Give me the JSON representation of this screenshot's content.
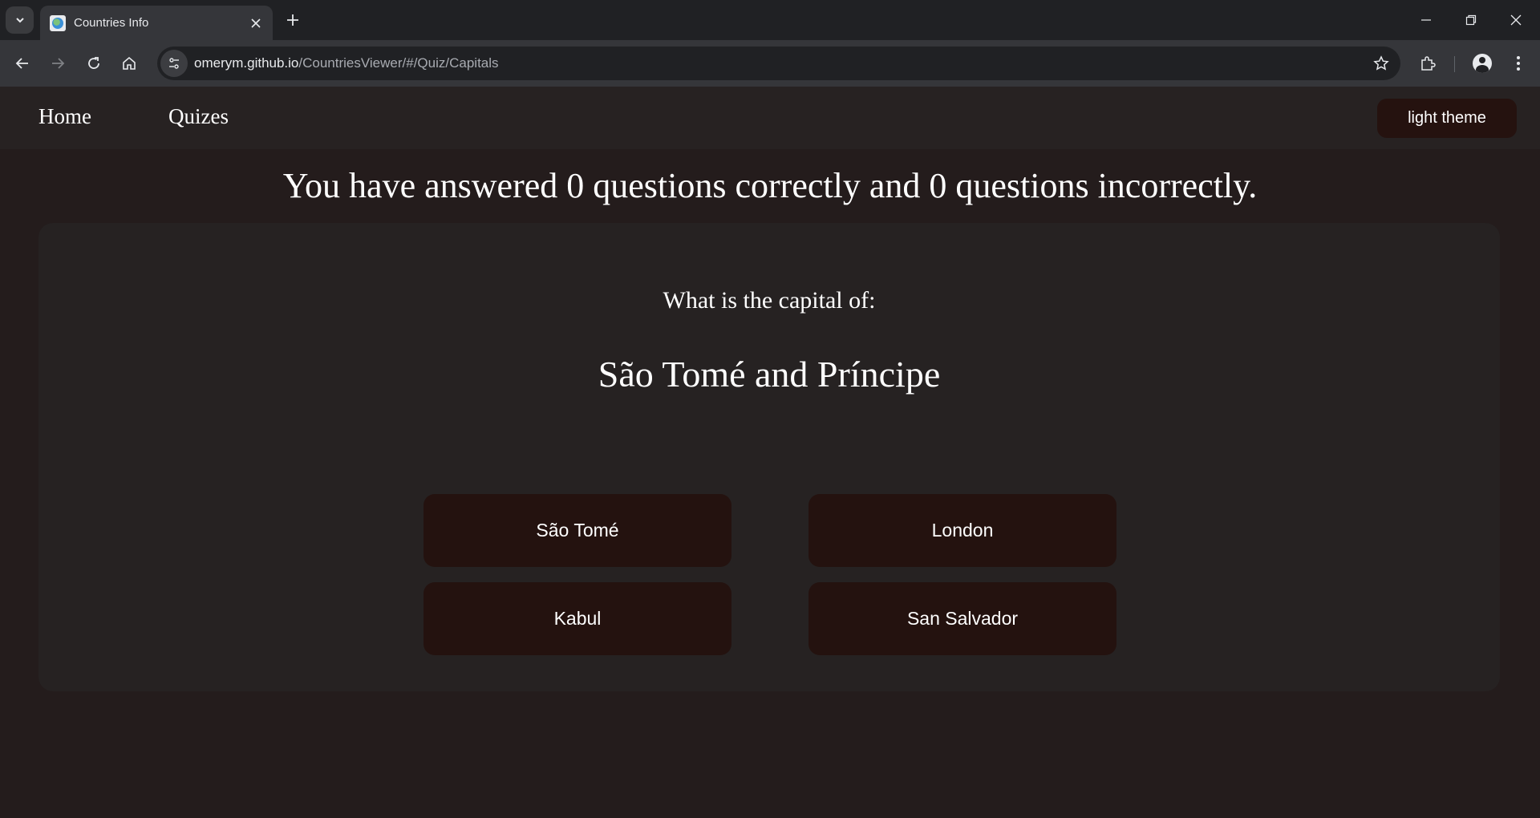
{
  "browser": {
    "tab_title": "Countries Info",
    "url_host": "omerym.github.io",
    "url_path": "/CountriesViewer/#/Quiz/Capitals"
  },
  "nav": {
    "home": "Home",
    "quizes": "Quizes",
    "theme_toggle": "light theme"
  },
  "score": {
    "text": "You have answered 0 questions correctly and 0 questions incorrectly.",
    "correct": 0,
    "incorrect": 0
  },
  "quiz": {
    "prompt": "What is the capital of:",
    "country": "São Tomé and Príncipe",
    "answers": [
      "São Tomé",
      "London",
      "Kabul",
      "San Salvador"
    ]
  },
  "colors": {
    "page_bg": "#241c1c",
    "nav_bg": "#272222",
    "card_bg": "#262222",
    "button_bg": "#24120f"
  }
}
